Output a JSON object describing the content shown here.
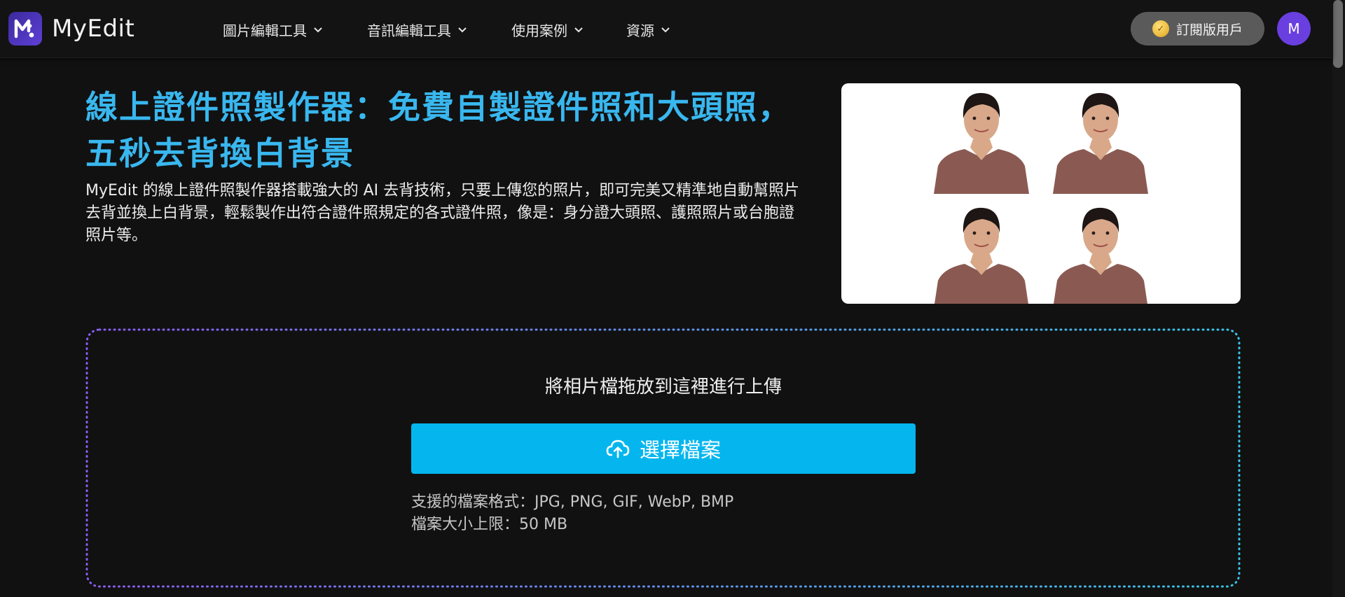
{
  "brand": {
    "name": "MyEdit"
  },
  "nav": {
    "items": [
      {
        "label": "圖片編輯工具"
      },
      {
        "label": "音訊編輯工具"
      },
      {
        "label": "使用案例"
      },
      {
        "label": "資源"
      }
    ],
    "subscription_label": "訂閱版用戶",
    "avatar_initial": "M"
  },
  "hero": {
    "title_line1": "線上證件照製作器：免費自製證件照和大頭照，",
    "title_line2": "五秒去背換白背景",
    "description": "MyEdit 的線上證件照製作器搭載強大的 AI 去背技術，只要上傳您的照片，即可完美又精準地自動幫照片去背並換上白背景，輕鬆製作出符合證件照規定的各式證件照，像是：身分證大頭照、護照照片或台胞證照片等。"
  },
  "upload": {
    "drop_text": "將相片檔拖放到這裡進行上傳",
    "button_label": "選擇檔案",
    "formats_text": "支援的檔案格式：JPG, PNG, GIF, WebP, BMP",
    "size_limit_text": "檔案大小上限：50 MB"
  },
  "colors": {
    "accent": "#05b6ee",
    "title": "#39b7ef",
    "avatar": "#6a3fe0",
    "background": "#111111"
  },
  "icons": {
    "logo": "myedit-logo-icon",
    "chevron": "chevron-down-icon",
    "medal": "medal-icon",
    "upload": "cloud-upload-icon"
  }
}
